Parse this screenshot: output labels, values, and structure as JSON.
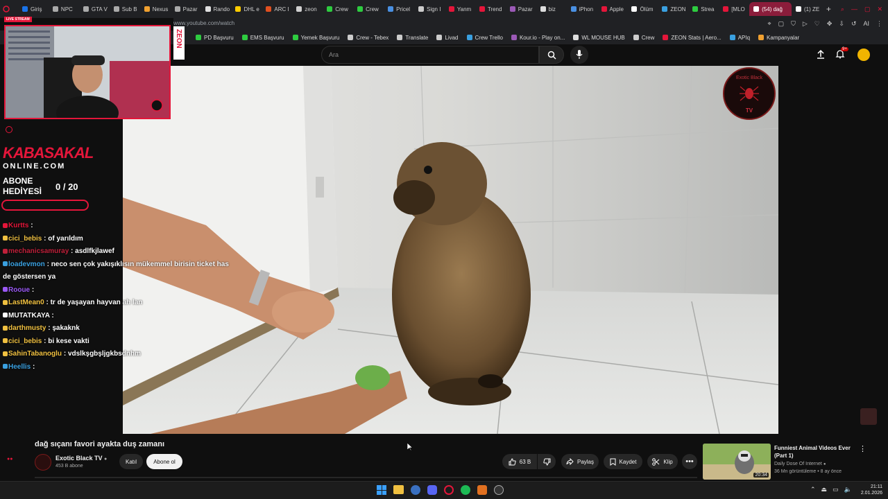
{
  "browser": {
    "tabs": [
      {
        "label": "Giriş",
        "color": "#1a73e8"
      },
      {
        "label": "NPC",
        "color": "#aaaaaa"
      },
      {
        "label": "GTA V",
        "color": "#aaaaaa"
      },
      {
        "label": "Sub B",
        "color": "#aaaaaa"
      },
      {
        "label": "Nexus",
        "color": "#f0a030"
      },
      {
        "label": "Pazar",
        "color": "#aaaaaa"
      },
      {
        "label": "Rando",
        "color": "#e0e0e0"
      },
      {
        "label": "DHL e",
        "color": "#ffcc00"
      },
      {
        "label": "ARC I",
        "color": "#e05020"
      },
      {
        "label": "zeon",
        "color": "#d0d0d0"
      },
      {
        "label": "Crew",
        "color": "#2ecc40"
      },
      {
        "label": "Crew",
        "color": "#2ecc40"
      },
      {
        "label": "Pricel",
        "color": "#4a90e2"
      },
      {
        "label": "Sign I",
        "color": "#cccccc"
      },
      {
        "label": "Yanm",
        "color": "#e4163a"
      },
      {
        "label": "Trend",
        "color": "#e4163a"
      },
      {
        "label": "Pazar",
        "color": "#9b59b6"
      },
      {
        "label": "biz",
        "color": "#dddddd"
      },
      {
        "label": "iPhon",
        "color": "#4a90e2"
      },
      {
        "label": "Apple",
        "color": "#e4163a"
      },
      {
        "label": "Ölüm",
        "color": "#ffffff"
      },
      {
        "label": "ZEON",
        "color": "#3aa0e0"
      },
      {
        "label": "Strea",
        "color": "#2ecc40"
      },
      {
        "label": "[MLO",
        "color": "#e4163a"
      },
      {
        "label": "(54) dağ",
        "color": "#ffffff"
      },
      {
        "label": "(1) ZE",
        "color": "#ffffff"
      }
    ],
    "active_tab_index": 24,
    "url": "www.youtube.com/watch",
    "bookmarks": [
      {
        "label": "PD Başvuru",
        "color": "#2ecc40"
      },
      {
        "label": "EMS Başvuru",
        "color": "#2ecc40"
      },
      {
        "label": "Yemek Başvuru",
        "color": "#2ecc40"
      },
      {
        "label": "Crew - Tebex",
        "color": "#cccccc"
      },
      {
        "label": "Translate",
        "color": "#cccccc"
      },
      {
        "label": "Livad",
        "color": "#cccccc"
      },
      {
        "label": "Crew Trello",
        "color": "#3aa0e0"
      },
      {
        "label": "Kour.io - Play on...",
        "color": "#9b59b6"
      },
      {
        "label": "WL MOUSE HUB",
        "color": "#dddddd"
      },
      {
        "label": "Crew",
        "color": "#cccccc"
      },
      {
        "label": "ZEON Stats | Aero...",
        "color": "#e4163a"
      },
      {
        "label": "APIq",
        "color": "#3aa0e0"
      },
      {
        "label": "Kampanyalar",
        "color": "#f0a030"
      }
    ],
    "right_toolbar_text": "AI"
  },
  "youtube": {
    "search_placeholder": "Ara",
    "notifications_badge": "9+",
    "video": {
      "watermark_channel": "Exotic Black",
      "watermark_sub": "TV"
    },
    "title": "dağ sıçanı favori ayakta duş zamanı",
    "channel_name": "Exotic Black TV",
    "subscribers": "453 B abone",
    "join_label": "Katıl",
    "subscribe_label": "Abone ol",
    "likes": "63 B",
    "share_label": "Paylaş",
    "save_label": "Kaydet",
    "clip_label": "Klip",
    "recommended": {
      "title": "Funniest Animal Videos Ever (Part 1)",
      "channel": "Daily Dose Of Internet",
      "meta": "36 Mn görüntüleme • 8 ay önce",
      "duration": "20:34"
    }
  },
  "stream_overlay": {
    "live_badge": "LIVE STREAM",
    "brand_top": "KABASAKAL",
    "brand_bottom": "ONLINE.COM",
    "sub_goal_label_1": "ABONE",
    "sub_goal_label_2": "HEDİYESİ",
    "sub_goal_count": "0  / 20",
    "side_tag": "ZEON"
  },
  "chat": [
    {
      "user": "Kurtts",
      "msg": "",
      "color": "#e4163a"
    },
    {
      "user": "cici_bebis",
      "msg": "of yarıldım",
      "color": "#f0c040"
    },
    {
      "user": "mechanicsamuray",
      "msg": "asdlfkjlawef",
      "color": "#c0203a"
    },
    {
      "user": "loadevmon",
      "msg": "neco sen çok yakışıklısın mükemmel birisin ticket has",
      "color": "#3aa0e0"
    },
    {
      "user": "",
      "msg": "de göstersen ya",
      "color": "#ffffff"
    },
    {
      "user": "Rooue",
      "msg": "",
      "color": "#9b59f6"
    },
    {
      "user": "LastMean0",
      "msg": "tr de yaşayan hayvan ah lan",
      "color": "#f0c040"
    },
    {
      "user": "MUTATKAYA",
      "msg": "",
      "color": "#ffffff"
    },
    {
      "user": "darthmusty",
      "msg": "şakaknk",
      "color": "#f0c040"
    },
    {
      "user": "cici_bebis",
      "msg": "bi kese vakti",
      "color": "#f0c040"
    },
    {
      "user": "SahinTabanoglu",
      "msg": "vdslkşgbşljgkbsdnhm",
      "color": "#f0c040"
    },
    {
      "user": "Heellis",
      "msg": "",
      "color": "#3aa0e0"
    }
  ],
  "taskbar": {
    "time": "21:11",
    "date": "2.01.2026"
  },
  "colors": {
    "accent": "#e4163a",
    "youtube_bg": "#0f0f0f",
    "pill": "#272727"
  }
}
